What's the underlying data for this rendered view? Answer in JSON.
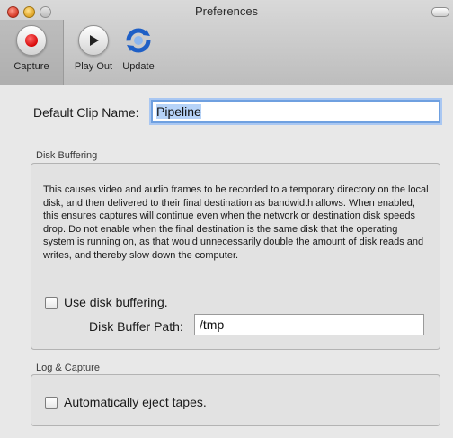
{
  "window": {
    "title": "Preferences"
  },
  "toolbar": {
    "capture_label": "Capture",
    "playout_label": "Play Out",
    "update_label": "Update"
  },
  "general": {
    "clip_name_label": "Default Clip Name:",
    "clip_name_value": "Pipeline"
  },
  "disk_buffering": {
    "section_title": "Disk Buffering",
    "description": "This causes video and audio frames to be recorded to a temporary directory on the local disk, and then delivered to their final destination as bandwidth allows. When enabled, this ensures captures will continue even when the network or destination disk speeds drop. Do not enable when the final destination is the same disk that the operating system is running on, as that would unnecessarily double the amount of disk reads and writes, and thereby slow down the computer.",
    "checkbox_label": "Use disk buffering.",
    "checkbox_checked": false,
    "path_label": "Disk Buffer Path:",
    "path_value": "/tmp"
  },
  "log_capture": {
    "section_title": "Log & Capture",
    "checkbox_label": "Automatically eject tapes.",
    "checkbox_checked": false
  },
  "icons": {
    "capture": "record-icon",
    "playout": "play-icon",
    "update": "refresh-icon"
  },
  "colors": {
    "record_red": "#d40000",
    "focus_ring": "#6fa0e0",
    "update_blue": "#1e5fc6"
  }
}
